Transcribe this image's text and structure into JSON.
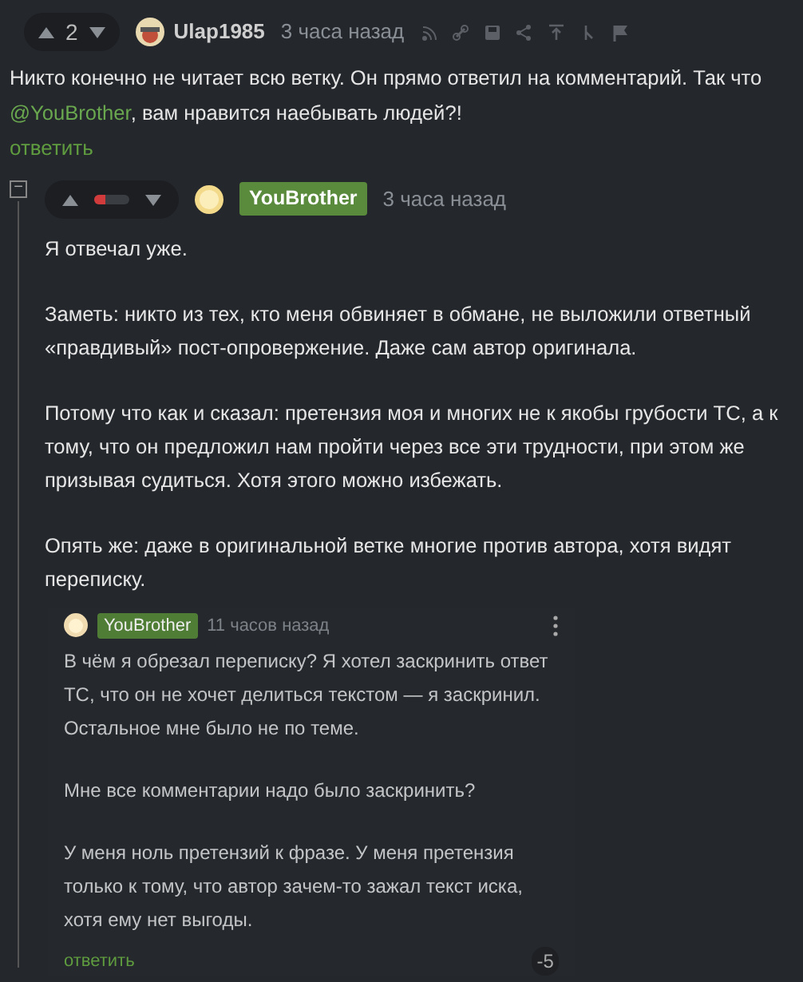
{
  "comment": {
    "rating": "2",
    "author": "Ulap1985",
    "time": "3 часа назад",
    "text": "Никто конечно не читает всю ветку. Он прямо ответил на комментарий. Так что ",
    "mention": "@YouBrother",
    "text_after": ", вам нравится наебывать людей?!",
    "reply": "ответить"
  },
  "reply_comment": {
    "collapse": "−",
    "level": 0.3,
    "author": "YouBrother",
    "time": "3 часа назад",
    "paragraphs": [
      "Я отвечал уже.",
      "Заметь: никто из тех, кто меня обвиняет в обмане, не выложили ответный «правдивый» пост-опровержение. Даже сам автор оригинала.",
      "Потому что как и сказал: претензия моя и многих не к якобы грубости ТС, а к тому, что он предложил нам пройти через все эти трудности, при этом же призывая судиться. Хотя этого можно избежать.",
      "Опять же: даже в оригинальной ветке многие против автора, хотя видят переписку."
    ],
    "screenshot": {
      "author": "YouBrother",
      "time": "11 часов назад",
      "paragraphs": [
        "В чём я обрезал переписку? Я хотел заскринить ответ ТС, что он не хочет делиться текстом — я заскринил. Остальное мне было не по теме.",
        "Мне все комментарии надо было заскринить?",
        "У меня ноль претензий к фразе. У меня претензия только к тому, что автор зачем-то зажал текст иска, хотя ему нет выгоды."
      ],
      "reply": "ответить",
      "rating": "-5"
    }
  }
}
